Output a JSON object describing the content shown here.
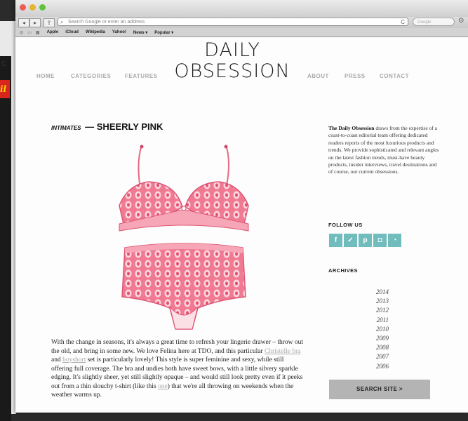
{
  "background_window": {
    "tag_text": "il",
    "mark": "C"
  },
  "browser": {
    "address_placeholder": "Search Google or enter an address",
    "search_placeholder": "Google",
    "nav_back": "◂",
    "nav_forward": "▸",
    "share": "⇪",
    "reload": "C",
    "bookmarks": [
      "Apple",
      "iCloud",
      "Wikipedia",
      "Yahoo!",
      "News ▾",
      "Popular ▾"
    ]
  },
  "site": {
    "logo_line1": "DAILY",
    "logo_line2": "OBSESSION",
    "nav": {
      "home": "HOME",
      "categories": "CATEGORIES",
      "features": "FEATURES",
      "about": "ABOUT",
      "press": "PRESS",
      "contact": "CONTACT"
    }
  },
  "post": {
    "category": "INTIMATES",
    "separator": "—",
    "title": "SHEERLY PINK",
    "body_1": "With the change in seasons, it's always a great time to refresh your lingerie drawer – throw out the old, and bring in some new.  We love Felina here at TDO, and this particular ",
    "link_1": "Christelle bra",
    "body_2": " and ",
    "link_2": "boyshort",
    "body_3": " set is particularly lovely! This style is super feminine and sexy, while still offering full coverage. The bra and undies both have sweet bows, with a little silvery sparkle edging. It's slightly sheer, yet still slightly opaque – and would still look pretty even if it peeks out from a thin slouchy t-shirt (like this ",
    "link_3": "one",
    "body_4": ") that we're all throwing on weekends when the weather warms up."
  },
  "sidebar": {
    "about_bold": "The Daily Obsession",
    "about_text": " draws from the expertise of a coast-to-coast editorial team offering dedicated readers reports of the most luxurious products and trends. We provide sophisticated and relevant angles on the latest fashion trends, must-have beauty products, insider interviews, travel destinations and of course, our current obsessions.",
    "follow_heading": "FOLLOW US",
    "social": [
      "f",
      "t",
      "p",
      "i",
      "rss"
    ],
    "archives_heading": "ARCHIVES",
    "archives": [
      "2014",
      "2013",
      "2012",
      "2011",
      "2010",
      "2009",
      "2008",
      "2007",
      "2006"
    ],
    "search_button": "SEARCH SITE >"
  },
  "colors": {
    "social_teal": "#71bcbc",
    "lingerie_pink": "#e9607d",
    "search_button_gray": "#b4b4b4"
  }
}
